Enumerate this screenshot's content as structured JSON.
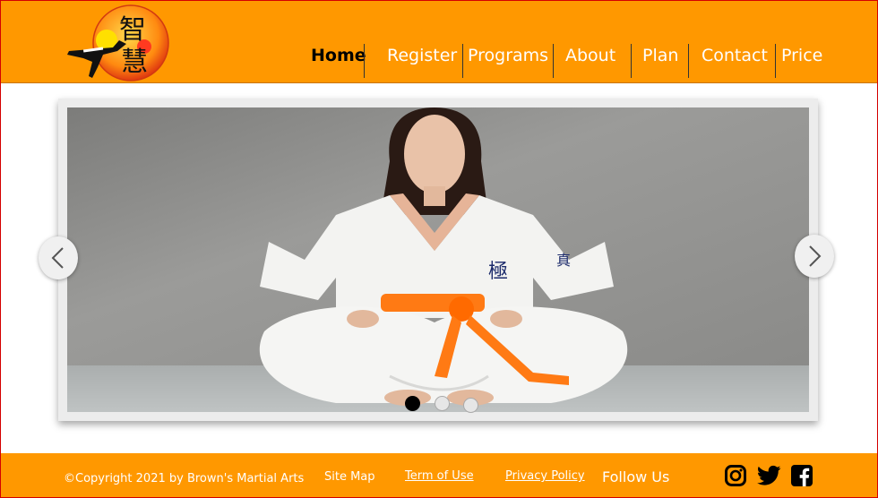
{
  "brand": {
    "logo_chars": [
      "智",
      "慧"
    ]
  },
  "nav": {
    "items": [
      {
        "label": "Home",
        "active": true
      },
      {
        "label": "Register",
        "active": false
      },
      {
        "label": "Programs",
        "active": false
      },
      {
        "label": "About",
        "active": false
      },
      {
        "label": "Plan",
        "active": false
      },
      {
        "label": "Contact",
        "active": false
      },
      {
        "label": "Price",
        "active": false
      }
    ]
  },
  "slider": {
    "slide_count": 3,
    "active_slide": 1,
    "icons": {
      "prev": "chevron-left-icon",
      "next": "chevron-right-icon"
    }
  },
  "footer": {
    "copyright": "©Copyright 2021 by Brown's Martial Arts",
    "site_map": "Site Map",
    "terms": "Term of Use",
    "privacy": "Privacy Policy",
    "follow": "Follow Us",
    "social_icons": [
      "instagram-icon",
      "twitter-icon",
      "facebook-icon"
    ]
  },
  "colors": {
    "brand_orange": "#ff9800",
    "belt_orange": "#ff7a14",
    "frame_red": "#d40000"
  }
}
